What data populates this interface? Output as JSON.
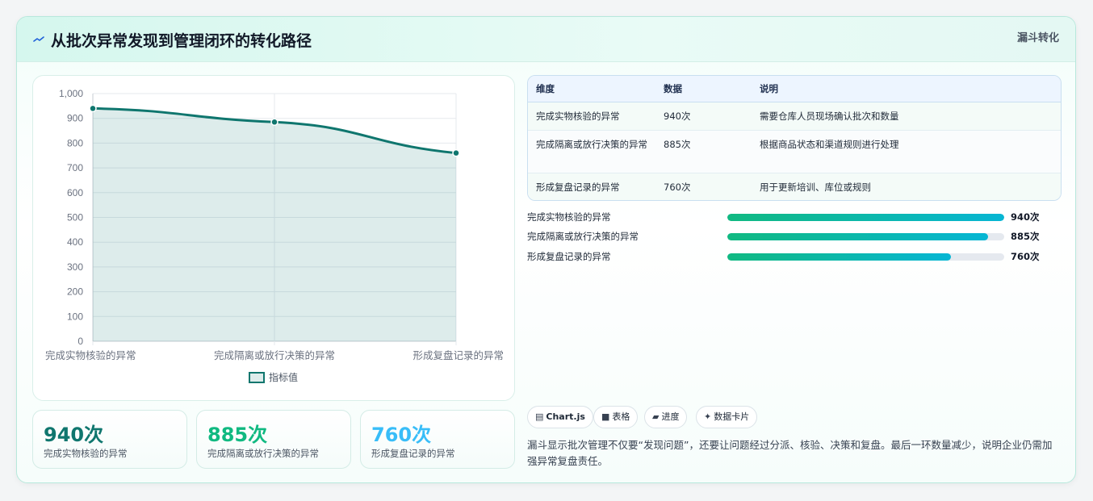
{
  "header": {
    "title": "从批次异常发现到管理闭环的转化路径",
    "tag": "漏斗转化",
    "icon": "wave-icon"
  },
  "chart_data": {
    "type": "line",
    "categories": [
      "完成实物核验的异常",
      "完成隔离或放行决策的异常",
      "形成复盘记录的异常"
    ],
    "series": [
      {
        "name": "指标值",
        "values": [
          940,
          885,
          760
        ]
      }
    ],
    "ylim": [
      0,
      1000
    ],
    "yticks": [
      "0",
      "100",
      "200",
      "300",
      "400",
      "500",
      "600",
      "700",
      "800",
      "900",
      "1,000"
    ],
    "grid": true,
    "legend": "bottom",
    "fill": true,
    "color": "#0f766e"
  },
  "stats": [
    {
      "value": "940次",
      "label": "完成实物核验的异常",
      "color": "#0f766e"
    },
    {
      "value": "885次",
      "label": "完成隔离或放行决策的异常",
      "color": "#10b981"
    },
    {
      "value": "760次",
      "label": "形成复盘记录的异常",
      "color": "#38bdf8"
    }
  ],
  "table": {
    "headers": [
      "维度",
      "数据",
      "说明"
    ],
    "rows": [
      {
        "dim": "完成实物核验的异常",
        "data": "940次",
        "desc": "需要仓库人员现场确认批次和数量"
      },
      {
        "dim": "完成隔离或放行决策的异常",
        "data": "885次",
        "desc": "根据商品状态和渠道规则进行处理"
      },
      {
        "dim": "形成复盘记录的异常",
        "data": "760次",
        "desc": "用于更新培训、库位或规则"
      }
    ]
  },
  "progress": [
    {
      "label": "完成实物核验的异常",
      "value": "940次",
      "fraction": 1.0
    },
    {
      "label": "完成隔离或放行决策的异常",
      "value": "885次",
      "fraction": 0.941
    },
    {
      "label": "形成复盘记录的异常",
      "value": "760次",
      "fraction": 0.809
    }
  ],
  "chips": [
    {
      "icon": "▤",
      "icon_name": "chart-icon",
      "label": "Chart.js"
    },
    {
      "icon": "■",
      "icon_name": "table-icon",
      "label": "表格"
    },
    {
      "icon": "▰",
      "icon_name": "progress-icon",
      "label": "进度"
    },
    {
      "icon": "✦",
      "icon_name": "card-icon",
      "label": "数据卡片"
    }
  ],
  "note": "漏斗显示批次管理不仅要“发现问题”，还要让问题经过分派、核验、决策和复盘。最后一环数量减少，说明企业仍需加强异常复盘责任。"
}
